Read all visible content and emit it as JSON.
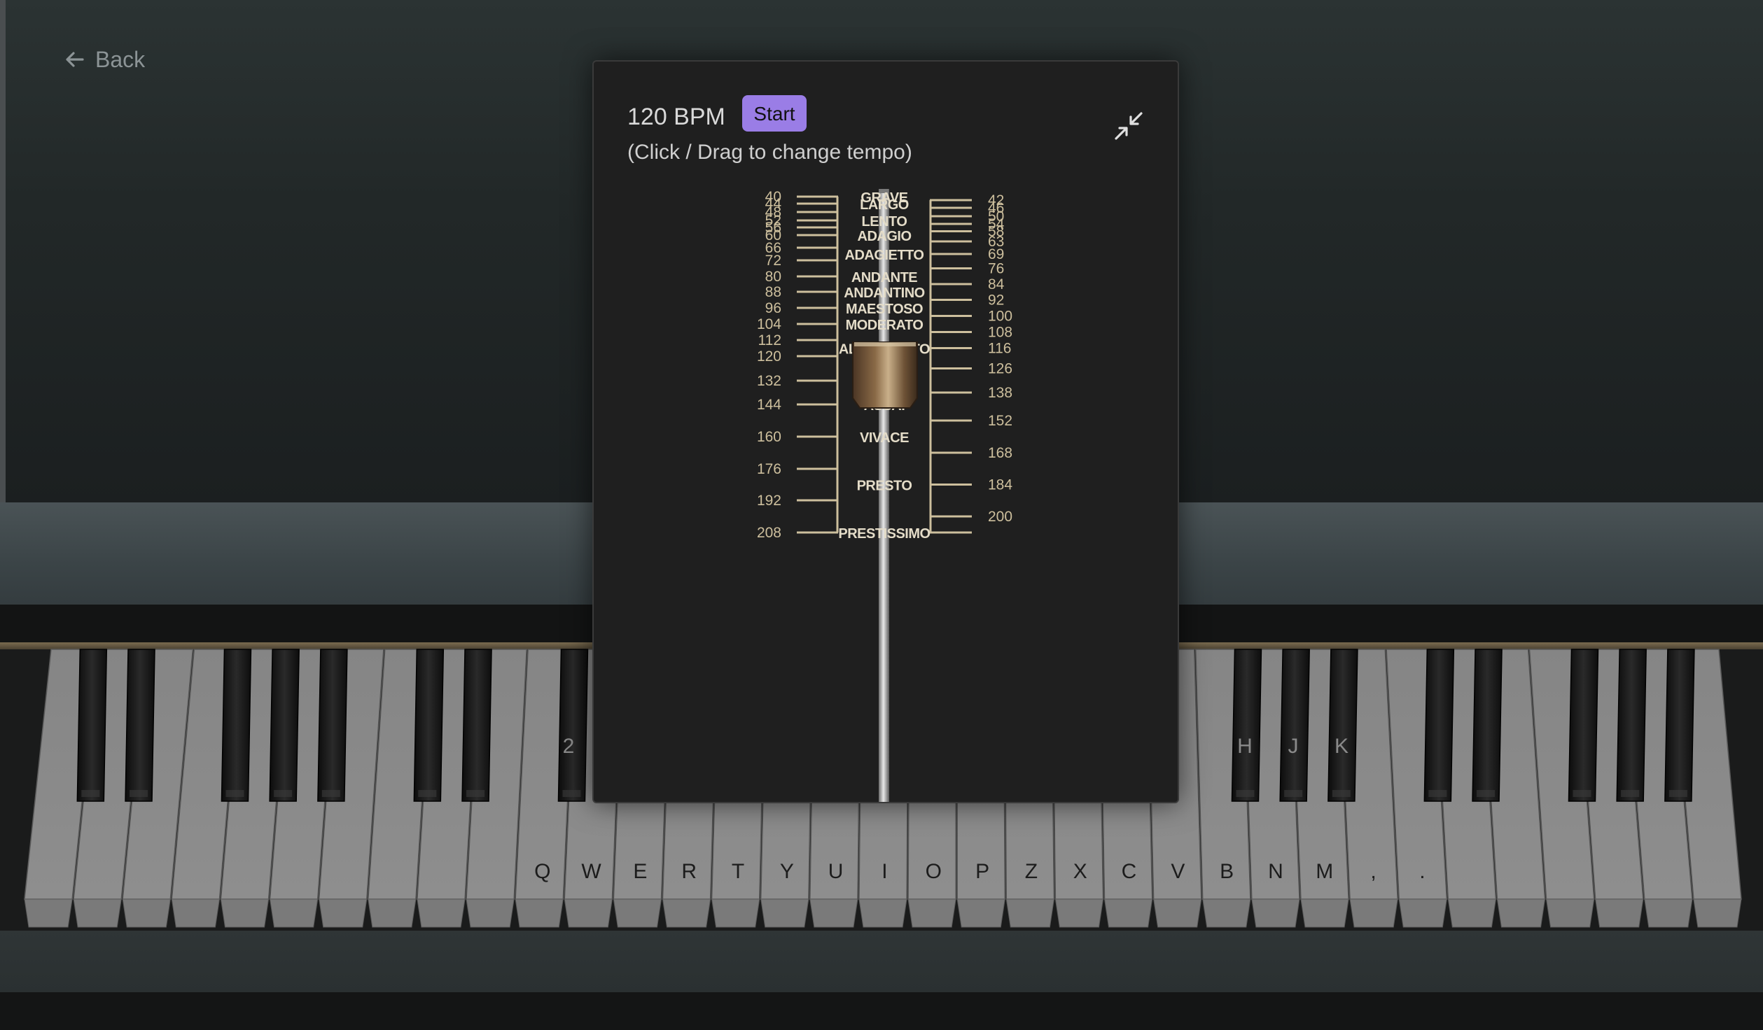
{
  "nav": {
    "back_label": "Back"
  },
  "metronome": {
    "bpm_text": "120 BPM",
    "bpm_value": 120,
    "start_label": "Start",
    "hint": "(Click / Drag to change tempo)",
    "left_scale": [
      40,
      44,
      48,
      52,
      56,
      60,
      66,
      72,
      80,
      88,
      96,
      104,
      112,
      120,
      132,
      144,
      160,
      176,
      192,
      208
    ],
    "right_scale": [
      42,
      46,
      50,
      54,
      58,
      63,
      69,
      76,
      84,
      92,
      100,
      108,
      116,
      126,
      138,
      152,
      168,
      184,
      200
    ],
    "tempo_markings": [
      {
        "label": "GRAVE",
        "bpm": 40
      },
      {
        "label": "LARGO",
        "bpm": 44
      },
      {
        "label": "LENTO",
        "bpm": 52
      },
      {
        "label": "ADAGIO",
        "bpm": 60
      },
      {
        "label": "ADAGIETTO",
        "bpm": 69
      },
      {
        "label": "ANDANTE",
        "bpm": 80
      },
      {
        "label": "ANDANTINO",
        "bpm": 88
      },
      {
        "label": "MAESTOSO",
        "bpm": 96
      },
      {
        "label": "MODERATO",
        "bpm": 104
      },
      {
        "label": "ALLEGRETTO",
        "bpm": 116
      },
      {
        "label": "ASSAI",
        "bpm": 144
      },
      {
        "label": "VIVACE",
        "bpm": 160
      },
      {
        "label": "PRESTO",
        "bpm": 184
      },
      {
        "label": "PRESTISSIMO",
        "bpm": 208
      }
    ]
  },
  "keyboard": {
    "white_labels": [
      "Q",
      "W",
      "E",
      "R",
      "T",
      "Y",
      "U",
      "I",
      "O",
      "P",
      "Z",
      "X",
      "C",
      "V",
      "B",
      "N",
      "M",
      ",",
      "."
    ],
    "black_labels": [
      "2",
      "H",
      "J",
      "K"
    ]
  },
  "colors": {
    "accent": "#9a7de6",
    "scale": "#cdbf9d",
    "panel": "#1f1f1f"
  }
}
